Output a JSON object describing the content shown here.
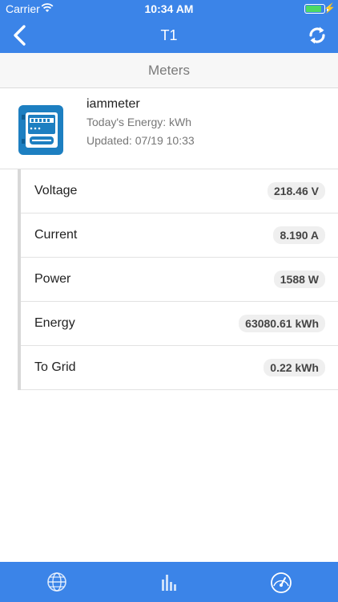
{
  "status_bar": {
    "carrier": "Carrier",
    "time": "10:34 AM",
    "battery_level": 0.9
  },
  "nav": {
    "title": "T1",
    "back_icon": "chevron-left-icon",
    "refresh_icon": "refresh-icon"
  },
  "section": {
    "title": "Meters"
  },
  "meter": {
    "name": "iammeter",
    "energy": "Today's Energy: kWh",
    "updated": "Updated: 07/19 10:33",
    "icon": "meter-icon"
  },
  "readings": [
    {
      "label": "Voltage",
      "value": "218.46 V"
    },
    {
      "label": "Current",
      "value": "8.190 A"
    },
    {
      "label": "Power",
      "value": "1588 W"
    },
    {
      "label": "Energy",
      "value": "63080.61 kWh"
    },
    {
      "label": "To Grid",
      "value": "0.22 kWh"
    }
  ],
  "tabs": [
    {
      "icon": "globe-icon"
    },
    {
      "icon": "bar-chart-icon"
    },
    {
      "icon": "gauge-icon"
    }
  ],
  "colors": {
    "accent": "#3b84e8",
    "battery": "#4cd964",
    "meter_icon": "#1d7fc1"
  }
}
